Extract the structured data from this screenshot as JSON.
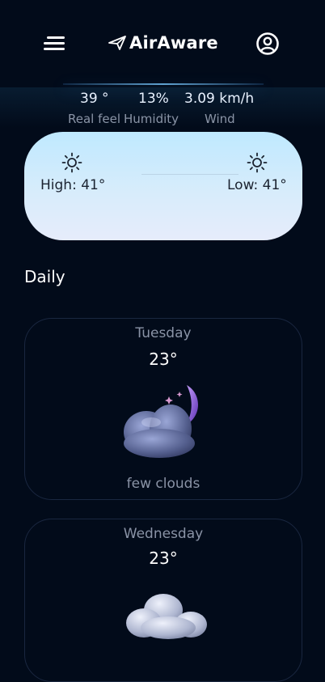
{
  "header": {
    "brand": "AirAware",
    "icons": {
      "menu": "menu-icon",
      "logo": "paper-plane-icon",
      "profile": "user-circle-icon"
    }
  },
  "stats": [
    {
      "value": "39 °",
      "label": "Real feel"
    },
    {
      "value": "13%",
      "label": "Humidity"
    },
    {
      "value": "3.09 km/h",
      "label": "Wind"
    }
  ],
  "high_low": {
    "high": "High: 41°",
    "low": "Low: 41°",
    "icon": "sun-icon"
  },
  "daily": {
    "title": "Daily",
    "days": [
      {
        "day": "Tuesday",
        "temp": "23°",
        "description": "few clouds",
        "icon": "cloud-moon-icon"
      },
      {
        "day": "Wednesday",
        "temp": "23°",
        "description": "",
        "icon": "clouds-icon"
      }
    ]
  },
  "colors": {
    "background": "#020b1a",
    "card_top": "#bfe9ff",
    "card_bottom": "#e6ecfb",
    "muted_text": "#8a93a6"
  }
}
